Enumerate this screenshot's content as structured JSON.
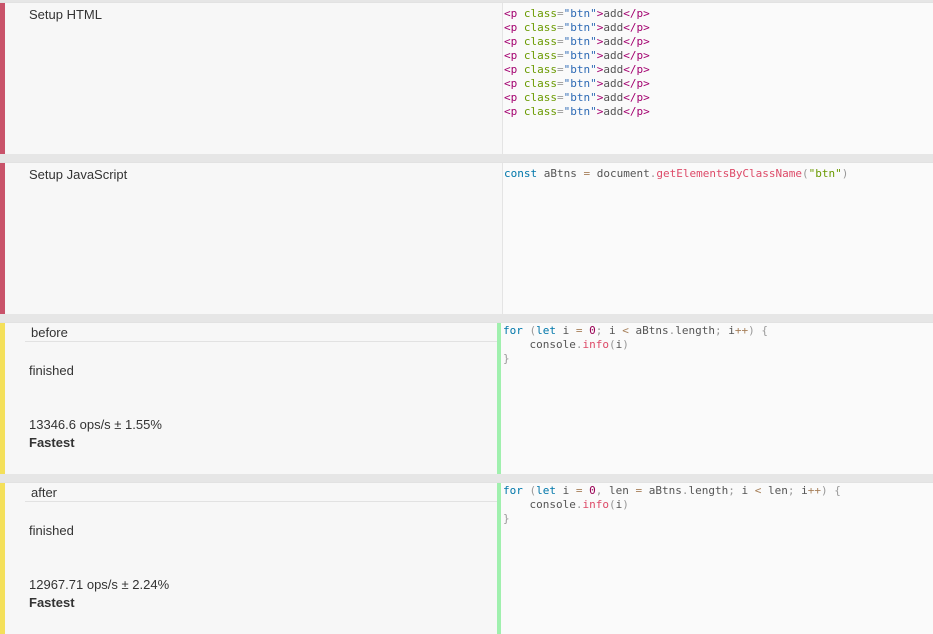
{
  "setup_html": {
    "label": "Setup HTML",
    "code_lines": [
      {
        "tag_open": "<p",
        "attr": "class",
        "eq": "=",
        "value": "\"btn\"",
        "close": ">",
        "text": "add",
        "tag_end": "</p>"
      },
      {
        "tag_open": "<p",
        "attr": "class",
        "eq": "=",
        "value": "\"btn\"",
        "close": ">",
        "text": "add",
        "tag_end": "</p>"
      },
      {
        "tag_open": "<p",
        "attr": "class",
        "eq": "=",
        "value": "\"btn\"",
        "close": ">",
        "text": "add",
        "tag_end": "</p>"
      },
      {
        "tag_open": "<p",
        "attr": "class",
        "eq": "=",
        "value": "\"btn\"",
        "close": ">",
        "text": "add",
        "tag_end": "</p>"
      },
      {
        "tag_open": "<p",
        "attr": "class",
        "eq": "=",
        "value": "\"btn\"",
        "close": ">",
        "text": "add",
        "tag_end": "</p>"
      },
      {
        "tag_open": "<p",
        "attr": "class",
        "eq": "=",
        "value": "\"btn\"",
        "close": ">",
        "text": "add",
        "tag_end": "</p>"
      },
      {
        "tag_open": "<p",
        "attr": "class",
        "eq": "=",
        "value": "\"btn\"",
        "close": ">",
        "text": "add",
        "tag_end": "</p>"
      },
      {
        "tag_open": "<p",
        "attr": "class",
        "eq": "=",
        "value": "\"btn\"",
        "close": ">",
        "text": "add",
        "tag_end": "</p>"
      }
    ]
  },
  "setup_js": {
    "label": "Setup JavaScript",
    "code": {
      "kw": "const",
      "var": " aBtns ",
      "op": "=",
      "obj": " document",
      "dot": ".",
      "fn": "getElementsByClassName",
      "paren_open": "(",
      "str": "\"btn\"",
      "paren_close": ")"
    }
  },
  "tests": [
    {
      "title": "before",
      "status": "finished",
      "result": "13346.6 ops/s ± 1.55%",
      "rank": "Fastest",
      "code": {
        "line1": {
          "kw_for": "for",
          "p1": " (",
          "kw_let": "let",
          "a": " i ",
          "op1": "=",
          "sp1": " ",
          "n0": "0",
          "semi1": ";",
          "b": " i ",
          "op2": "<",
          "c": " aBtns",
          "dot": ".",
          "d": "length",
          "semi2": ";",
          "e": " i",
          "op3": "++",
          "p2": ")",
          "f": " ",
          "brace": "{"
        },
        "line2": {
          "indent": "    console",
          "dot": ".",
          "fn": "info",
          "p1": "(",
          "arg": "i",
          "p2": ")"
        },
        "line3": {
          "brace": "}"
        }
      }
    },
    {
      "title": "after",
      "status": "finished",
      "result": "12967.71 ops/s ± 2.24%",
      "rank": "Fastest",
      "code": {
        "line1": {
          "kw_for": "for",
          "p1": " (",
          "kw_let": "let",
          "a": " i ",
          "op1": "=",
          "sp1": " ",
          "n0": "0",
          "comma": ",",
          "g": " len ",
          "op4": "=",
          "c": " aBtns",
          "dot": ".",
          "d": "length",
          "semi1": ";",
          "b": " i ",
          "op2": "<",
          "h": " len",
          "semi2": ";",
          "e": " i",
          "op3": "++",
          "p2": ")",
          "f": " ",
          "brace": "{"
        },
        "line2": {
          "indent": "    console",
          "dot": ".",
          "fn": "info",
          "p1": "(",
          "arg": "i",
          "p2": ")"
        },
        "line3": {
          "brace": "}"
        }
      }
    }
  ],
  "colors": {
    "setup_accent": "#c9536a",
    "test_accent": "#f4e05a",
    "active_editor_border": "#a0f0ae"
  }
}
